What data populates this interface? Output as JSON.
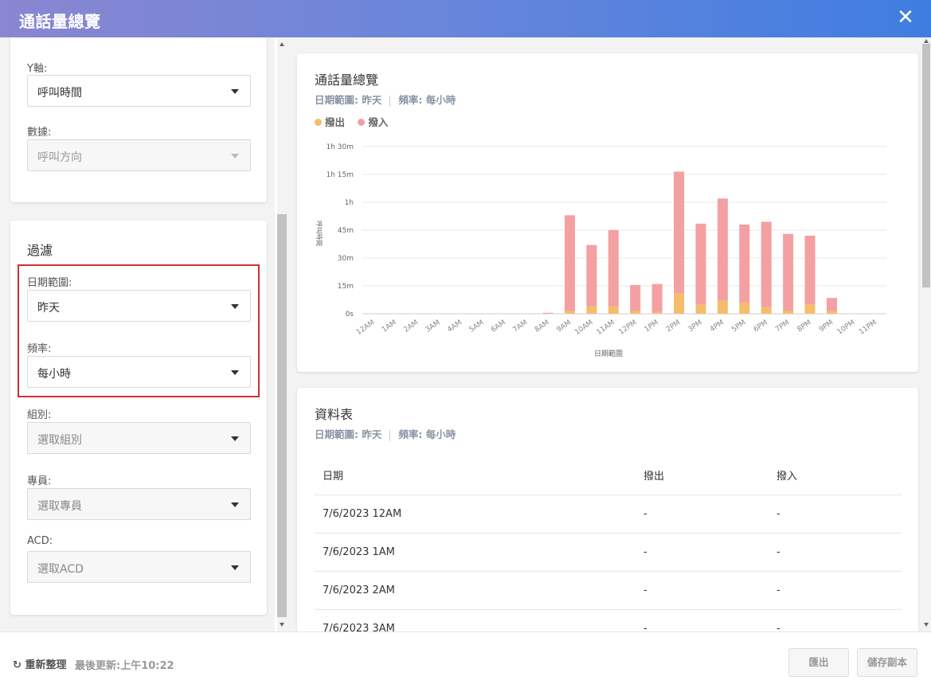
{
  "window": {
    "title": "通話量總覽",
    "close_glyph": "✕"
  },
  "settings": {
    "y_axis": {
      "label": "Y軸:",
      "value": "呼叫時間"
    },
    "data_field": {
      "label": "數據:",
      "value": "呼叫方向"
    }
  },
  "filter": {
    "title": "過濾",
    "date_range": {
      "label": "日期範圍:",
      "value": "昨天"
    },
    "frequency": {
      "label": "頻率:",
      "value": "每小時"
    },
    "group": {
      "label": "組別:",
      "placeholder": "選取組別"
    },
    "agent": {
      "label": "專員:",
      "placeholder": "選取專員"
    },
    "acd": {
      "label": "ACD:",
      "placeholder": "選取ACD"
    }
  },
  "chart_card": {
    "title": "通話量總覽",
    "date_meta": "日期範圍: 昨天",
    "freq_meta": "頻率: 每小時",
    "legend": [
      {
        "name": "撥出",
        "color": "#f5bd6b"
      },
      {
        "name": "撥入",
        "color": "#f4a0a2"
      }
    ]
  },
  "chart_data": {
    "type": "bar",
    "stacked": true,
    "xlabel": "日期範圍",
    "ylabel": "呼叫時間",
    "y_unit": "minutes",
    "ylim": [
      0,
      90
    ],
    "yticks": [
      {
        "value": 0,
        "label": "0s"
      },
      {
        "value": 15,
        "label": "15m"
      },
      {
        "value": 30,
        "label": "30m"
      },
      {
        "value": 45,
        "label": "45m"
      },
      {
        "value": 60,
        "label": "1h"
      },
      {
        "value": 75,
        "label": "1h 15m"
      },
      {
        "value": 90,
        "label": "1h 30m"
      }
    ],
    "categories": [
      "12AM",
      "1AM",
      "2AM",
      "3AM",
      "4AM",
      "5AM",
      "6AM",
      "7AM",
      "8AM",
      "9AM",
      "10AM",
      "11AM",
      "12PM",
      "1PM",
      "2PM",
      "3PM",
      "4PM",
      "5PM",
      "6PM",
      "7PM",
      "8PM",
      "9PM",
      "10PM",
      "11PM"
    ],
    "series": [
      {
        "name": "撥出",
        "color": "#f5bd6b",
        "values": [
          0,
          0,
          0,
          0,
          0,
          0,
          0,
          0,
          0,
          1.5,
          4,
          4,
          1.5,
          1,
          11,
          5,
          7,
          6,
          3.5,
          1.5,
          5,
          1.5,
          0,
          0
        ]
      },
      {
        "name": "撥入",
        "color": "#f4a0a2",
        "values": [
          0,
          0,
          0,
          0,
          0,
          0,
          0,
          0,
          0.5,
          51.5,
          33,
          41,
          14,
          15,
          65.5,
          43.5,
          55,
          42,
          46,
          41.5,
          37,
          7,
          0,
          0
        ]
      }
    ],
    "grid": true,
    "legend_position": "top-left"
  },
  "table_card": {
    "title": "資料表",
    "date_meta": "日期範圍: 昨天",
    "freq_meta": "頻率: 每小時",
    "columns": [
      "日期",
      "撥出",
      "撥入"
    ],
    "rows": [
      [
        "7/6/2023 12AM",
        "-",
        "-"
      ],
      [
        "7/6/2023 1AM",
        "-",
        "-"
      ],
      [
        "7/6/2023 2AM",
        "-",
        "-"
      ],
      [
        "7/6/2023 3AM",
        "-",
        "-"
      ]
    ]
  },
  "footer": {
    "refresh_icon": "↻",
    "refresh_label": "重新整理",
    "last_updated": "最後更新:上午10:22",
    "export_label": "匯出",
    "save_copy_label": "儲存副本"
  }
}
